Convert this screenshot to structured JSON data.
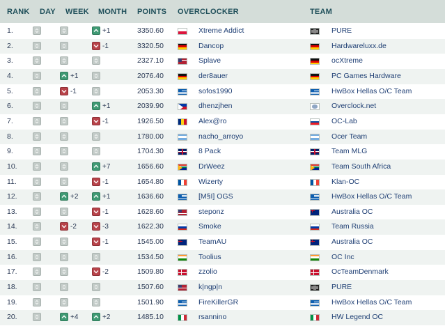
{
  "header": {
    "rank": "RANK",
    "day": "DAY",
    "week": "WEEK",
    "month": "MONTH",
    "points": "POINTS",
    "overclocker": "OVERCLOCKER",
    "team": "TEAM"
  },
  "colors": {
    "header_bg": "#d4ddd9",
    "row_alt": "#eff3f1",
    "up": "#3f9a74",
    "down": "#b8434a",
    "neutral": "#c3cbc8",
    "link": "#1f3f74"
  },
  "rows": [
    {
      "rank": "1.",
      "day": {
        "dir": "none",
        "val": ""
      },
      "week": {
        "dir": "none",
        "val": ""
      },
      "month": {
        "dir": "up",
        "val": "+1"
      },
      "points": "3350.60",
      "overclocker": "Xtreme Addict",
      "oc_flag": "poland",
      "team": "PURE",
      "team_flag": "pure-logo"
    },
    {
      "rank": "2.",
      "day": {
        "dir": "none",
        "val": ""
      },
      "week": {
        "dir": "none",
        "val": ""
      },
      "month": {
        "dir": "down",
        "val": "-1"
      },
      "points": "3320.50",
      "overclocker": "Dancop",
      "oc_flag": "germany",
      "team": "Hardwareluxx.de",
      "team_flag": "germany"
    },
    {
      "rank": "3.",
      "day": {
        "dir": "none",
        "val": ""
      },
      "week": {
        "dir": "none",
        "val": ""
      },
      "month": {
        "dir": "none",
        "val": ""
      },
      "points": "2327.10",
      "overclocker": "Splave",
      "oc_flag": "usa",
      "team": "ocXtreme",
      "team_flag": "germany"
    },
    {
      "rank": "4.",
      "day": {
        "dir": "none",
        "val": ""
      },
      "week": {
        "dir": "up",
        "val": "+1"
      },
      "month": {
        "dir": "none",
        "val": ""
      },
      "points": "2076.40",
      "overclocker": "der8auer",
      "oc_flag": "germany",
      "team": "PC Games Hardware",
      "team_flag": "germany"
    },
    {
      "rank": "5.",
      "day": {
        "dir": "none",
        "val": ""
      },
      "week": {
        "dir": "down",
        "val": "-1"
      },
      "month": {
        "dir": "none",
        "val": ""
      },
      "points": "2053.30",
      "overclocker": "sofos1990",
      "oc_flag": "greece",
      "team": "HwBox Hellas O/C Team",
      "team_flag": "greece"
    },
    {
      "rank": "6.",
      "day": {
        "dir": "none",
        "val": ""
      },
      "week": {
        "dir": "none",
        "val": ""
      },
      "month": {
        "dir": "up",
        "val": "+1"
      },
      "points": "2039.90",
      "overclocker": "dhenzjhen",
      "oc_flag": "philippines",
      "team": "Overclock.net",
      "team_flag": "ocn-logo"
    },
    {
      "rank": "7.",
      "day": {
        "dir": "none",
        "val": ""
      },
      "week": {
        "dir": "none",
        "val": ""
      },
      "month": {
        "dir": "down",
        "val": "-1"
      },
      "points": "1926.50",
      "overclocker": "Alex@ro",
      "oc_flag": "romania",
      "team": "OC-Lab",
      "team_flag": "slovakia"
    },
    {
      "rank": "8.",
      "day": {
        "dir": "none",
        "val": ""
      },
      "week": {
        "dir": "none",
        "val": ""
      },
      "month": {
        "dir": "none",
        "val": ""
      },
      "points": "1780.00",
      "overclocker": "nacho_arroyo",
      "oc_flag": "argentina",
      "team": "Ocer Team",
      "team_flag": "argentina"
    },
    {
      "rank": "9.",
      "day": {
        "dir": "none",
        "val": ""
      },
      "week": {
        "dir": "none",
        "val": ""
      },
      "month": {
        "dir": "none",
        "val": ""
      },
      "points": "1704.30",
      "overclocker": "8 Pack",
      "oc_flag": "uk",
      "team": "Team MLG",
      "team_flag": "uk"
    },
    {
      "rank": "10.",
      "day": {
        "dir": "none",
        "val": ""
      },
      "week": {
        "dir": "none",
        "val": ""
      },
      "month": {
        "dir": "up",
        "val": "+7"
      },
      "points": "1656.60",
      "overclocker": "DrWeez",
      "oc_flag": "south-africa",
      "team": "Team South Africa",
      "team_flag": "south-africa"
    },
    {
      "rank": "11.",
      "day": {
        "dir": "none",
        "val": ""
      },
      "week": {
        "dir": "none",
        "val": ""
      },
      "month": {
        "dir": "down",
        "val": "-1"
      },
      "points": "1654.80",
      "overclocker": "Wizerty",
      "oc_flag": "france",
      "team": "Klan-OC",
      "team_flag": "france"
    },
    {
      "rank": "12.",
      "day": {
        "dir": "none",
        "val": ""
      },
      "week": {
        "dir": "up",
        "val": "+2"
      },
      "month": {
        "dir": "up",
        "val": "+1"
      },
      "points": "1636.60",
      "overclocker": "[M§I] OGS",
      "oc_flag": "greece",
      "team": "HwBox Hellas O/C Team",
      "team_flag": "greece"
    },
    {
      "rank": "13.",
      "day": {
        "dir": "none",
        "val": ""
      },
      "week": {
        "dir": "none",
        "val": ""
      },
      "month": {
        "dir": "down",
        "val": "-1"
      },
      "points": "1628.60",
      "overclocker": "steponz",
      "oc_flag": "usa",
      "team": "Australia OC",
      "team_flag": "australia"
    },
    {
      "rank": "14.",
      "day": {
        "dir": "none",
        "val": ""
      },
      "week": {
        "dir": "down",
        "val": "-2"
      },
      "month": {
        "dir": "down",
        "val": "-3"
      },
      "points": "1622.30",
      "overclocker": "Smoke",
      "oc_flag": "russia",
      "team": "Team Russia",
      "team_flag": "russia"
    },
    {
      "rank": "15.",
      "day": {
        "dir": "none",
        "val": ""
      },
      "week": {
        "dir": "none",
        "val": ""
      },
      "month": {
        "dir": "down",
        "val": "-1"
      },
      "points": "1545.00",
      "overclocker": "TeamAU",
      "oc_flag": "australia",
      "team": "Australia OC",
      "team_flag": "australia"
    },
    {
      "rank": "16.",
      "day": {
        "dir": "none",
        "val": ""
      },
      "week": {
        "dir": "none",
        "val": ""
      },
      "month": {
        "dir": "none",
        "val": ""
      },
      "points": "1534.50",
      "overclocker": "Toolius",
      "oc_flag": "india",
      "team": "OC Inc",
      "team_flag": "india"
    },
    {
      "rank": "17.",
      "day": {
        "dir": "none",
        "val": ""
      },
      "week": {
        "dir": "none",
        "val": ""
      },
      "month": {
        "dir": "down",
        "val": "-2"
      },
      "points": "1509.80",
      "overclocker": "zzolio",
      "oc_flag": "denmark",
      "team": "OcTeamDenmark",
      "team_flag": "denmark"
    },
    {
      "rank": "18.",
      "day": {
        "dir": "none",
        "val": ""
      },
      "week": {
        "dir": "none",
        "val": ""
      },
      "month": {
        "dir": "none",
        "val": ""
      },
      "points": "1507.60",
      "overclocker": "k|ngp|n",
      "oc_flag": "usa",
      "team": "PURE",
      "team_flag": "pure-logo"
    },
    {
      "rank": "19.",
      "day": {
        "dir": "none",
        "val": ""
      },
      "week": {
        "dir": "none",
        "val": ""
      },
      "month": {
        "dir": "none",
        "val": ""
      },
      "points": "1501.90",
      "overclocker": "FireKillerGR",
      "oc_flag": "greece",
      "team": "HwBox Hellas O/C Team",
      "team_flag": "greece"
    },
    {
      "rank": "20.",
      "day": {
        "dir": "none",
        "val": ""
      },
      "week": {
        "dir": "up",
        "val": "+4"
      },
      "month": {
        "dir": "up",
        "val": "+2"
      },
      "points": "1485.10",
      "overclocker": "rsannino",
      "oc_flag": "italy",
      "team": "HW Legend OC",
      "team_flag": "italy"
    }
  ]
}
